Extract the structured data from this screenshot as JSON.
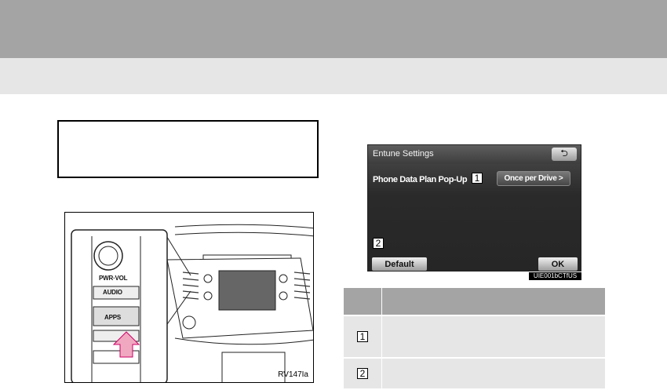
{
  "illustration": {
    "buttons": {
      "power_volume": "PWR·VOL",
      "audio": "AUDIO",
      "apps": "APPS"
    },
    "code": "RV147Ia"
  },
  "screen": {
    "title": "Entune Settings",
    "setting_label": "Phone Data Plan Pop-Up",
    "setting_value": "Once per Drive >",
    "marker_1": "1",
    "marker_2": "2",
    "default_label": "Default",
    "ok_label": "OK",
    "back_icon": "back-arrow-icon",
    "code": "UIE001bCTfUS"
  },
  "table": {
    "rows": [
      {
        "marker": "1"
      },
      {
        "marker": "2"
      }
    ]
  },
  "colors": {
    "band_dark": "#a4a4a4",
    "band_light": "#e6e6e6",
    "arrow": "#f0a8c0"
  }
}
